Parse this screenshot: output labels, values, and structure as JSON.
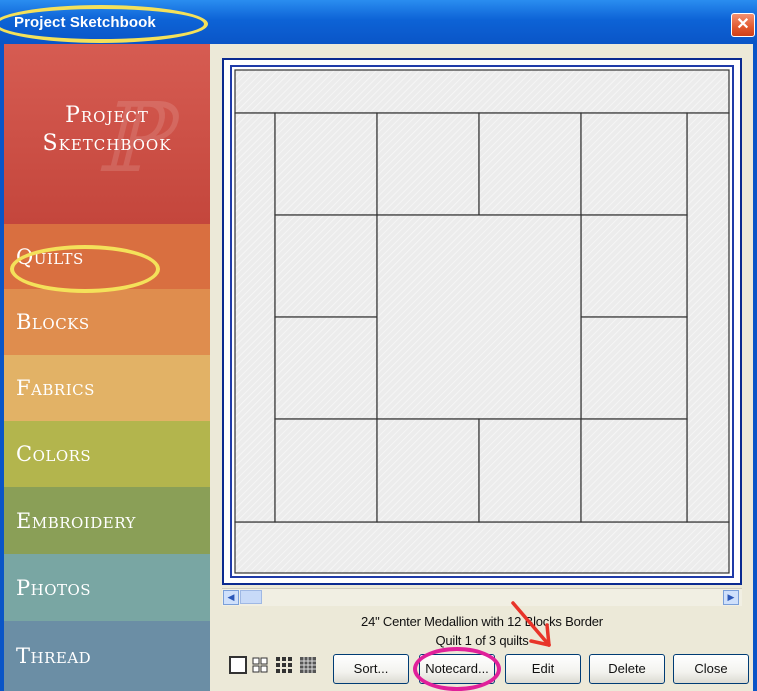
{
  "window": {
    "title": "Project Sketchbook",
    "close_glyph": "✕"
  },
  "sidebar": {
    "header_title_line1": "Project",
    "header_title_line2": "Sketchbook",
    "items": [
      {
        "label": "Quilts",
        "color": "#d96f40"
      },
      {
        "label": "Blocks",
        "color": "#df8d4e"
      },
      {
        "label": "Fabrics",
        "color": "#e2b266"
      },
      {
        "label": "Colors",
        "color": "#b3b54d"
      },
      {
        "label": "Embroidery",
        "color": "#8a9f57"
      },
      {
        "label": "Photos",
        "color": "#79a6a3"
      },
      {
        "label": "Thread",
        "color": "#6b8ea5"
      }
    ]
  },
  "preview": {
    "caption_title": "24\" Center Medallion with 12 Blocks Border",
    "caption_count": "Quilt 1 of 3 quilts"
  },
  "scrollbar": {
    "left_glyph": "◀",
    "right_glyph": "▶"
  },
  "toolbar": {
    "view_icons": [
      "single-view-icon",
      "four-view-icon",
      "nine-view-icon",
      "sixteen-view-icon"
    ],
    "buttons": {
      "sort": "Sort...",
      "notecard": "Notecard...",
      "edit": "Edit",
      "delete": "Delete",
      "close": "Close"
    }
  },
  "annotations": {
    "highlight_yellow": "#f4e15a",
    "highlight_magenta": "#e0209a",
    "arrow_red": "#e8342a"
  }
}
